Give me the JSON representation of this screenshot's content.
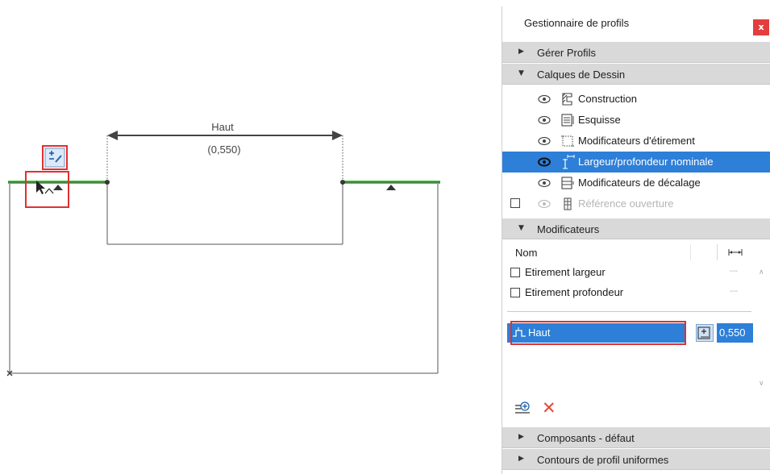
{
  "canvas": {
    "dimension_label": "Haut",
    "dimension_value": "(0,550)"
  },
  "panel": {
    "title": "Gestionnaire de profils",
    "close_glyph": "x",
    "sections": {
      "manage": {
        "label": "Gérer Profils",
        "state": "collapsed"
      },
      "layers": {
        "label": "Calques de Dessin",
        "state": "expanded"
      },
      "modifiers": {
        "label": "Modificateurs",
        "state": "expanded"
      },
      "components": {
        "label": "Composants - défaut",
        "state": "collapsed"
      },
      "contours": {
        "label": "Contours de profil uniformes",
        "state": "collapsed"
      }
    },
    "layers": [
      {
        "name": "Construction",
        "icon": "construction-layer-icon",
        "visible": true
      },
      {
        "name": "Esquisse",
        "icon": "sketch-layer-icon",
        "visible": true
      },
      {
        "name": "Modificateurs d'étirement",
        "icon": "stretch-modifier-layer-icon",
        "visible": true
      },
      {
        "name": "Largeur/profondeur nominale",
        "icon": "nominal-size-layer-icon",
        "visible": true,
        "selected": true
      },
      {
        "name": "Modificateurs de décalage",
        "icon": "offset-modifier-layer-icon",
        "visible": true
      },
      {
        "name": "Référence ouverture",
        "icon": "opening-reference-layer-icon",
        "visible": false,
        "checked": false
      }
    ],
    "modifiers_table": {
      "col_name": "Nom",
      "col_value_icon": "dimension-icon",
      "rows": [
        {
          "name": "Etirement largeur",
          "value": "---",
          "checked": false
        },
        {
          "name": "Etirement profondeur",
          "value": "---",
          "checked": false
        }
      ],
      "offset": {
        "name": "Haut",
        "value": "0,550"
      }
    },
    "colors": {
      "selection": "#2d7fd8",
      "highlight_green": "#46c840",
      "callout_red": "#e03030"
    }
  }
}
